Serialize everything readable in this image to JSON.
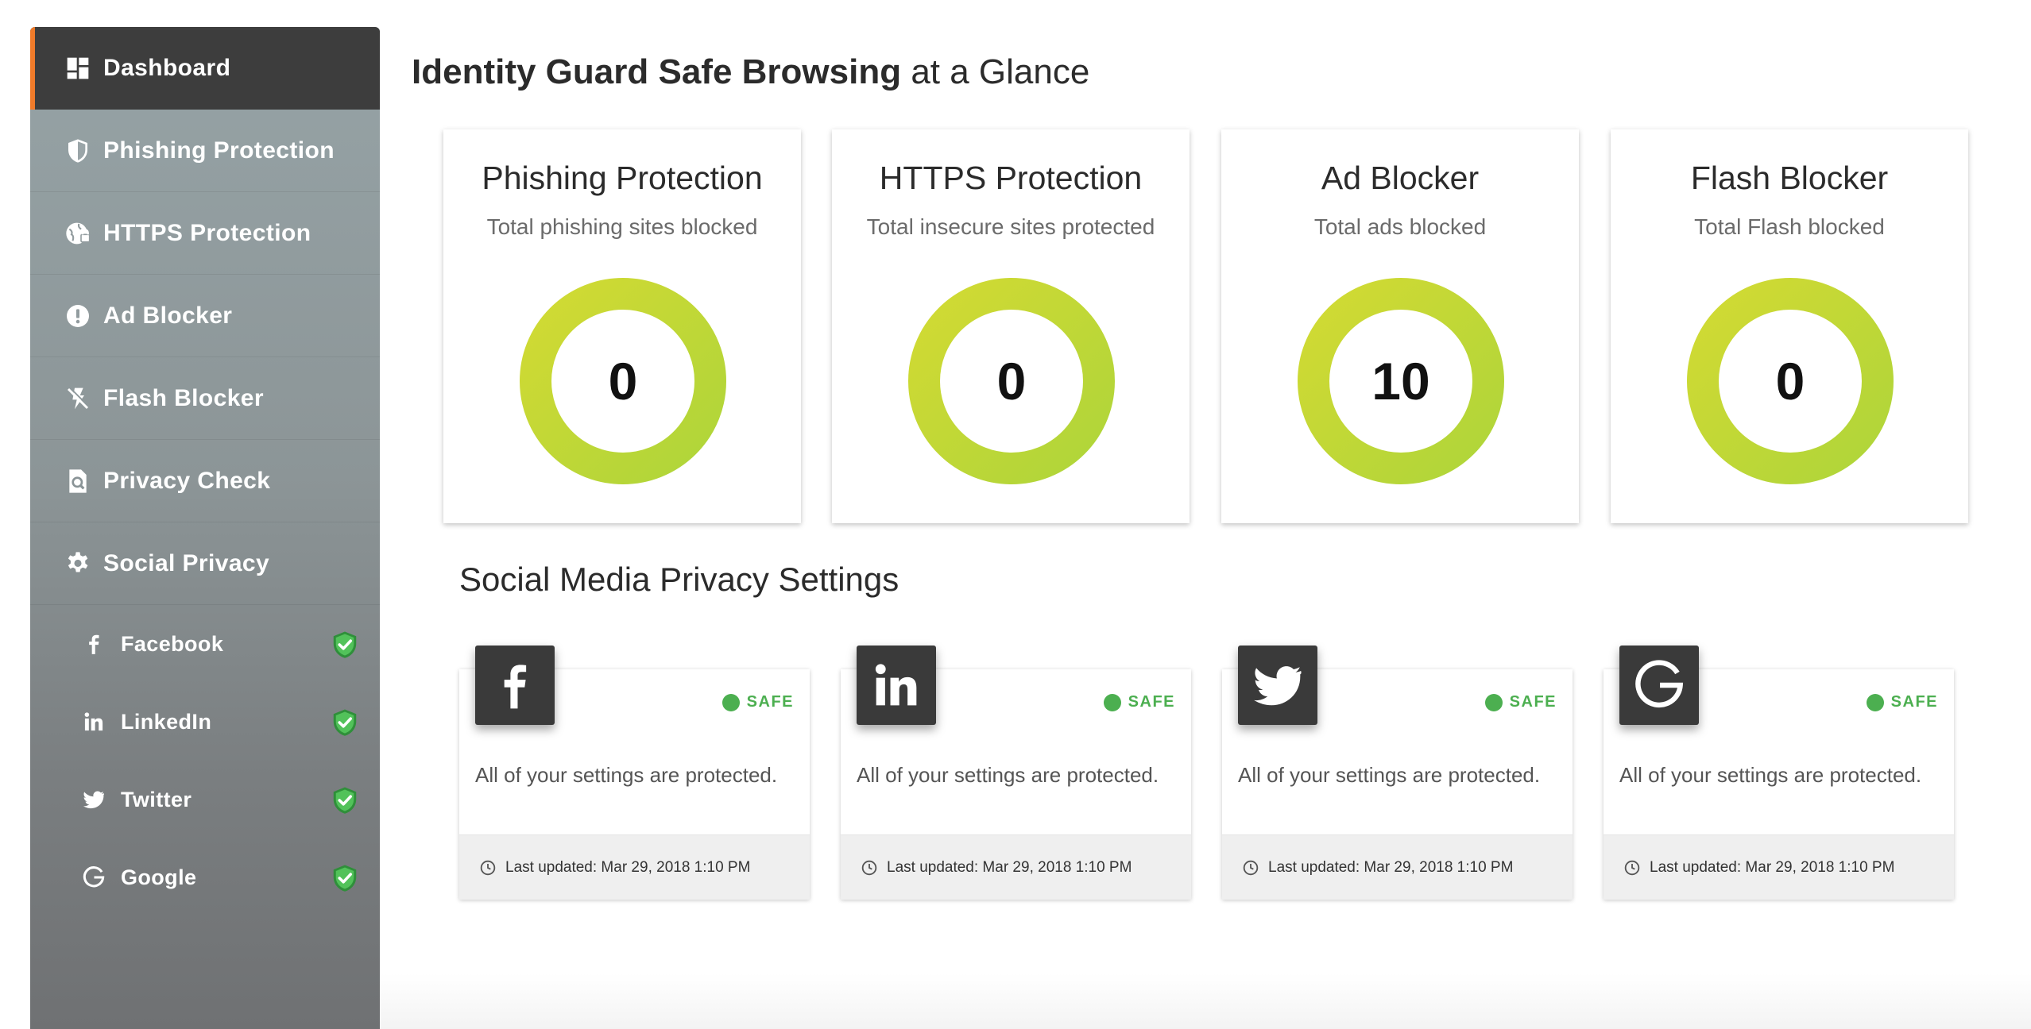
{
  "colors": {
    "accent": "#f07b2a",
    "sidebar_active": "#3d3d3d",
    "donut": "#bed635",
    "safe": "#4caf50",
    "logo_tile": "#3a3a3a"
  },
  "sidebar": {
    "items": [
      {
        "label": "Dashboard",
        "icon": "dashboard-icon",
        "active": true
      },
      {
        "label": "Phishing Protection",
        "icon": "shield-icon"
      },
      {
        "label": "HTTPS Protection",
        "icon": "globe-lock-icon"
      },
      {
        "label": "Ad Blocker",
        "icon": "alert-circle-icon"
      },
      {
        "label": "Flash Blocker",
        "icon": "flash-off-icon"
      },
      {
        "label": "Privacy Check",
        "icon": "document-search-icon"
      },
      {
        "label": "Social Privacy",
        "icon": "gear-icon"
      }
    ],
    "sub_items": [
      {
        "label": "Facebook",
        "icon": "facebook-icon",
        "status_icon": "shield-check-icon"
      },
      {
        "label": "LinkedIn",
        "icon": "linkedin-icon",
        "status_icon": "shield-check-icon"
      },
      {
        "label": "Twitter",
        "icon": "twitter-icon",
        "status_icon": "shield-check-icon"
      },
      {
        "label": "Google",
        "icon": "google-icon",
        "status_icon": "shield-check-icon"
      }
    ]
  },
  "header": {
    "title_bold": "Identity Guard Safe Browsing",
    "title_rest": " at a Glance"
  },
  "stats": [
    {
      "title": "Phishing Protection",
      "subtitle": "Total phishing sites blocked",
      "value": "0"
    },
    {
      "title": "HTTPS Protection",
      "subtitle": "Total insecure sites protected",
      "value": "0"
    },
    {
      "title": "Ad Blocker",
      "subtitle": "Total ads blocked",
      "value": "10"
    },
    {
      "title": "Flash Blocker",
      "subtitle": "Total Flash blocked",
      "value": "0"
    }
  ],
  "social": {
    "title": "Social Media Privacy Settings",
    "cards": [
      {
        "network": "facebook",
        "icon": "facebook-icon",
        "status": "SAFE",
        "message": "All of your settings are protected.",
        "updated": "Last updated: Mar 29, 2018 1:10 PM"
      },
      {
        "network": "linkedin",
        "icon": "linkedin-icon",
        "status": "SAFE",
        "message": "All of your settings are protected.",
        "updated": "Last updated: Mar 29, 2018 1:10 PM"
      },
      {
        "network": "twitter",
        "icon": "twitter-icon",
        "status": "SAFE",
        "message": "All of your settings are protected.",
        "updated": "Last updated: Mar 29, 2018 1:10 PM"
      },
      {
        "network": "google",
        "icon": "google-icon",
        "status": "SAFE",
        "message": "All of your settings are protected.",
        "updated": "Last updated: Mar 29, 2018 1:10 PM"
      }
    ]
  }
}
